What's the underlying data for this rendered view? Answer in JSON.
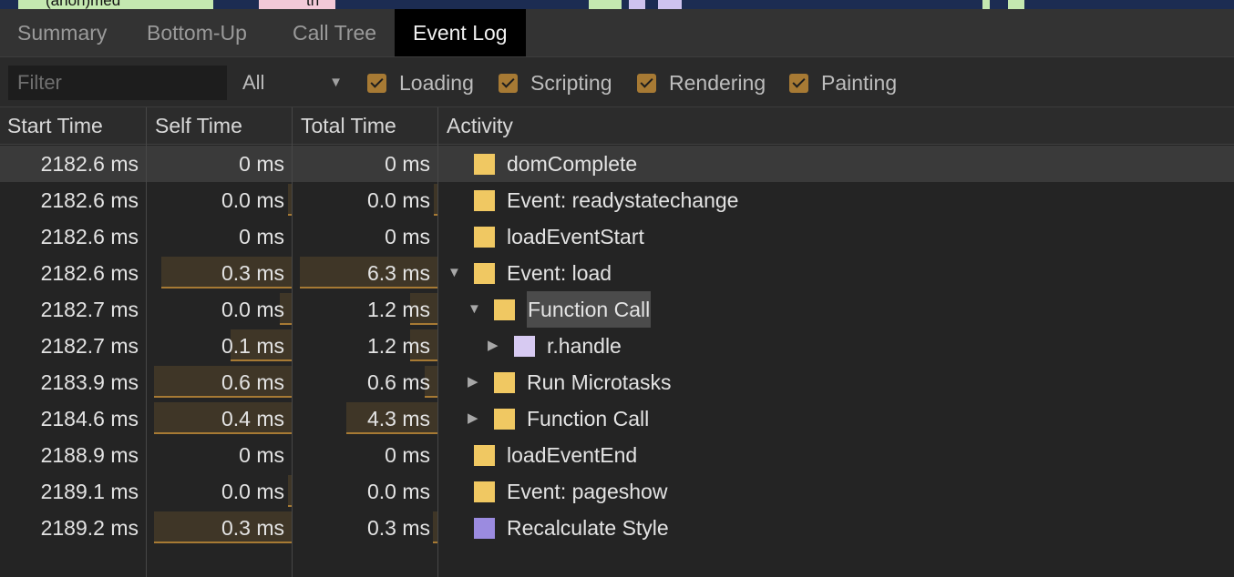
{
  "timeline_strip": {
    "labels": [
      "(anon)med",
      "tn"
    ],
    "colors": {
      "background": "#1c2c52",
      "green": "#c4e8b0",
      "pink": "#f3c9d8",
      "purple": "#cfc3ef"
    }
  },
  "tabs": [
    {
      "label": "Summary",
      "active": false
    },
    {
      "label": "Bottom-Up",
      "active": false
    },
    {
      "label": "Call Tree",
      "active": false
    },
    {
      "label": "Event Log",
      "active": true
    }
  ],
  "filter": {
    "placeholder": "Filter",
    "value": "",
    "duration_select": "All",
    "categories": [
      {
        "label": "Loading",
        "checked": true
      },
      {
        "label": "Scripting",
        "checked": true
      },
      {
        "label": "Rendering",
        "checked": true
      },
      {
        "label": "Painting",
        "checked": true
      }
    ]
  },
  "table": {
    "headers": {
      "start": "Start Time",
      "self": "Self Time",
      "total": "Total Time",
      "activity": "Activity"
    },
    "rows": [
      {
        "start": "2182.6 ms",
        "self": "0 ms",
        "total": "0 ms",
        "activity": "domComplete",
        "category": "loading",
        "color": "#f0c862",
        "depth": 0,
        "expander": "",
        "self_frac": 0,
        "total_frac": 0,
        "selected": true,
        "highlighted": false
      },
      {
        "start": "2182.6 ms",
        "self": "0.0 ms",
        "total": "0.0 ms",
        "activity": "Event: readystatechange",
        "category": "scripting",
        "color": "#f0c862",
        "depth": 0,
        "expander": "",
        "self_frac": 0.02,
        "total_frac": 0.02,
        "selected": false,
        "highlighted": false
      },
      {
        "start": "2182.6 ms",
        "self": "0 ms",
        "total": "0 ms",
        "activity": "loadEventStart",
        "category": "loading",
        "color": "#f0c862",
        "depth": 0,
        "expander": "",
        "self_frac": 0,
        "total_frac": 0,
        "selected": false,
        "highlighted": false
      },
      {
        "start": "2182.6 ms",
        "self": "0.3 ms",
        "total": "6.3 ms",
        "activity": "Event: load",
        "category": "scripting",
        "color": "#f0c862",
        "depth": 0,
        "expander": "expanded",
        "self_frac": 0.9,
        "total_frac": 0.95,
        "selected": false,
        "highlighted": false
      },
      {
        "start": "2182.7 ms",
        "self": "0.0 ms",
        "total": "1.2 ms",
        "activity": "Function Call",
        "category": "scripting",
        "color": "#f0c862",
        "depth": 1,
        "expander": "expanded",
        "self_frac": 0.08,
        "total_frac": 0.19,
        "selected": false,
        "highlighted": true
      },
      {
        "start": "2182.7 ms",
        "self": "0.1 ms",
        "total": "1.2 ms",
        "activity": "r.handle",
        "category": "scripting",
        "color": "#d7caf2",
        "depth": 2,
        "expander": "collapsed",
        "self_frac": 0.42,
        "total_frac": 0.19,
        "selected": false,
        "highlighted": false
      },
      {
        "start": "2183.9 ms",
        "self": "0.6 ms",
        "total": "0.6 ms",
        "activity": "Run Microtasks",
        "category": "scripting",
        "color": "#f0c862",
        "depth": 1,
        "expander": "collapsed",
        "self_frac": 0.95,
        "total_frac": 0.09,
        "selected": false,
        "highlighted": false
      },
      {
        "start": "2184.6 ms",
        "self": "0.4 ms",
        "total": "4.3 ms",
        "activity": "Function Call",
        "category": "scripting",
        "color": "#f0c862",
        "depth": 1,
        "expander": "collapsed",
        "self_frac": 0.95,
        "total_frac": 0.63,
        "selected": false,
        "highlighted": false
      },
      {
        "start": "2188.9 ms",
        "self": "0 ms",
        "total": "0 ms",
        "activity": "loadEventEnd",
        "category": "loading",
        "color": "#f0c862",
        "depth": 0,
        "expander": "",
        "self_frac": 0,
        "total_frac": 0,
        "selected": false,
        "highlighted": false
      },
      {
        "start": "2189.1 ms",
        "self": "0.0 ms",
        "total": "0.0 ms",
        "activity": "Event: pageshow",
        "category": "scripting",
        "color": "#f0c862",
        "depth": 0,
        "expander": "",
        "self_frac": 0.02,
        "total_frac": 0,
        "selected": false,
        "highlighted": false
      },
      {
        "start": "2189.2 ms",
        "self": "0.3 ms",
        "total": "0.3 ms",
        "activity": "Recalculate Style",
        "category": "rendering",
        "color": "#9b8be0",
        "depth": 0,
        "expander": "",
        "self_frac": 0.95,
        "total_frac": 0.03,
        "selected": false,
        "highlighted": false
      }
    ]
  },
  "colors": {
    "accent": "#a77a34",
    "bar_fill": "#3f3627",
    "background": "#242424"
  },
  "icons": {
    "expanded": "triangle-down-icon",
    "collapsed": "triangle-right-icon",
    "dropdown": "dropdown-arrow-icon",
    "check": "checkmark-icon"
  }
}
